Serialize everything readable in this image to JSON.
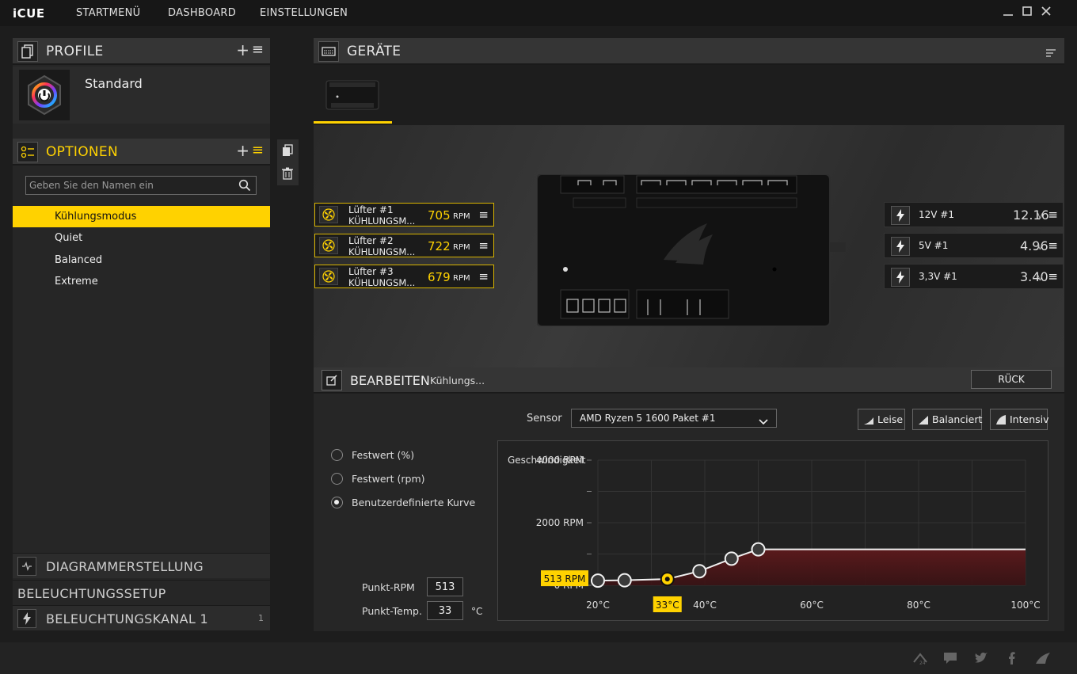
{
  "app": {
    "logo": "iCUE",
    "nav": [
      "STARTMENÜ",
      "DASHBOARD",
      "EINSTELLUNGEN"
    ]
  },
  "profile": {
    "header": "PROFILE",
    "name": "Standard"
  },
  "options": {
    "header": "OPTIONEN",
    "search_placeholder": "Geben Sie den Namen ein",
    "items": [
      "Kühlungsmodus",
      "Quiet",
      "Balanced",
      "Extreme"
    ],
    "active_index": 0
  },
  "bottom_sections": {
    "diagram": "DIAGRAMMERSTELLUNG",
    "lighting_setup": "BELEUCHTUNGSSETUP",
    "lighting_channel": "BELEUCHTUNGSKANAL 1",
    "lighting_channel_count": "1"
  },
  "devices": {
    "header": "GERÄTE"
  },
  "fans": [
    {
      "name": "Lüfter #1",
      "mode": "KÜHLUNGSM...",
      "rpm": "705",
      "unit": "RPM"
    },
    {
      "name": "Lüfter #2",
      "mode": "KÜHLUNGSM...",
      "rpm": "722",
      "unit": "RPM"
    },
    {
      "name": "Lüfter #3",
      "mode": "KÜHLUNGSM...",
      "rpm": "679",
      "unit": "RPM"
    }
  ],
  "voltages": [
    {
      "name": "12V #1",
      "value": "12.16",
      "unit": "V"
    },
    {
      "name": "5V #1",
      "value": "4.96",
      "unit": "V"
    },
    {
      "name": "3,3V #1",
      "value": "3.40",
      "unit": "V"
    }
  ],
  "edit": {
    "header": "BEARBEITEN",
    "subject": "Kühlungs...",
    "back_button": "RÜCK",
    "sensor_label": "Sensor",
    "sensor_value": "AMD Ryzen 5 1600 Paket #1",
    "presets": [
      "Leise",
      "Balanciert",
      "Intensiv"
    ],
    "modes": [
      "Festwert (%)",
      "Festwert (rpm)",
      "Benutzerdefinierte Kurve"
    ],
    "selected_mode": 2,
    "point_rpm_label": "Punkt-RPM",
    "point_rpm": "513",
    "point_temp_label": "Punkt-Temp.",
    "point_temp": "33",
    "point_temp_unit": "°C"
  },
  "colors": {
    "accent": "#ffd200",
    "curve_fill": "#5a1a1c",
    "curve_line": "#f0f0f0"
  },
  "chart_data": {
    "type": "line",
    "ylabel": "Geschwindigkeit",
    "y_tick_labels": [
      "4000 RPM",
      "2000 RPM",
      "0 RPM"
    ],
    "x_tick_labels": [
      "20°C",
      "40°C",
      "60°C",
      "80°C",
      "100°C"
    ],
    "xlim": [
      20,
      100
    ],
    "ylim": [
      0,
      4000
    ],
    "grid": true,
    "points": [
      {
        "x": 20,
        "y": 150
      },
      {
        "x": 25,
        "y": 160
      },
      {
        "x": 33,
        "y": 200
      },
      {
        "x": 39,
        "y": 450
      },
      {
        "x": 45,
        "y": 850
      },
      {
        "x": 50,
        "y": 1150
      }
    ],
    "flat_until": 100,
    "selected_point": 2,
    "selected_rpm_label": "513 RPM",
    "selected_temp_label": "33°C"
  }
}
